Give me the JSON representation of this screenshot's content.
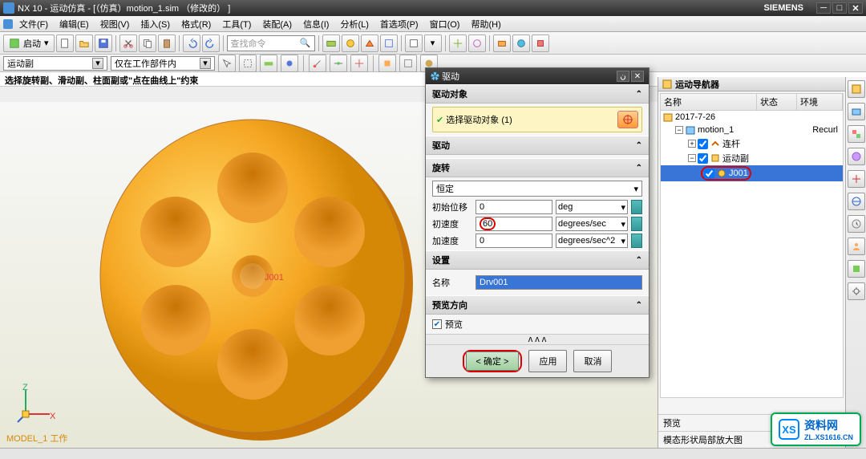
{
  "title": "NX 10 - 运动仿真 - [（仿真）motion_1.sim （修改的） ]",
  "brand": "SIEMENS",
  "menu": {
    "file": "文件(F)",
    "edit": "编辑(E)",
    "view": "视图(V)",
    "insert": "插入(S)",
    "format": "格式(R)",
    "tools": "工具(T)",
    "assy": "装配(A)",
    "info": "信息(I)",
    "analysis": "分析(L)",
    "pref": "首选项(P)",
    "window": "窗口(O)",
    "help": "帮助(H)"
  },
  "toolbar": {
    "start": "启动",
    "search_ph": "查找命令"
  },
  "selbar": {
    "filter": "运动副",
    "scope": "仅在工作部件内"
  },
  "prompt": "选择旋转副、滑动副、柱面副或\"点在曲线上\"约束",
  "model_label": "MODEL_1 工作",
  "nav": {
    "title": "运动导航器",
    "col_name": "名称",
    "col_state": "状态",
    "col_env": "环境",
    "root": "2017-7-26",
    "motion": "motion_1",
    "motion_env": "Recurl",
    "links": "连杆",
    "joints": "运动副",
    "j001": "J001"
  },
  "footer": {
    "preview": "预览",
    "layout": "模态形状局部放大图"
  },
  "dlg": {
    "title": "驱动",
    "sec_target": "驱动对象",
    "sel_label": "选择驱动对象 (1)",
    "sec_drive": "驱动",
    "sec_rotate": "旋转",
    "type": "恒定",
    "f_disp": "初始位移",
    "v_disp": "0",
    "u_disp": "deg",
    "f_vel": "初速度",
    "v_vel": "60",
    "u_vel": "degrees/sec",
    "f_acc": "加速度",
    "v_acc": "0",
    "u_acc": "degrees/sec^2",
    "sec_set": "设置",
    "f_name": "名称",
    "v_name": "Drv001",
    "sec_prev": "预览方向",
    "cb_prev": "预览",
    "ok": "确定",
    "apply": "应用",
    "cancel": "取消"
  },
  "watermark": {
    "name": "资料网",
    "url": "ZL.XS1616.CN"
  }
}
